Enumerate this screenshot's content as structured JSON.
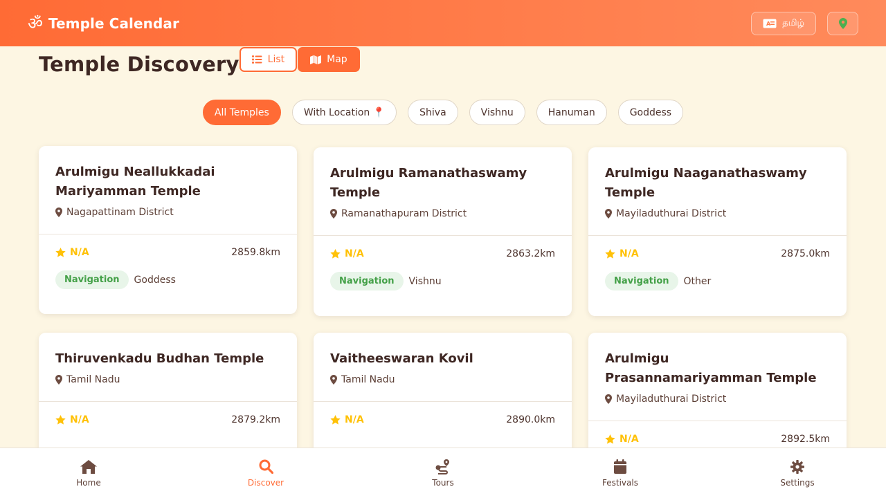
{
  "header": {
    "brand_symbol": "ॐ",
    "title": "Temple Calendar",
    "language_label": "தமிழ்",
    "accent": "#ff6b35"
  },
  "page": {
    "title": "Temple Discovery",
    "view_toggle": {
      "list_label": "List",
      "map_label": "Map",
      "selected": "Map"
    }
  },
  "filters": [
    {
      "label": "All Temples",
      "active": true
    },
    {
      "label": "With Location 📍",
      "active": false
    },
    {
      "label": "Shiva",
      "active": false
    },
    {
      "label": "Vishnu",
      "active": false
    },
    {
      "label": "Hanuman",
      "active": false
    },
    {
      "label": "Goddess",
      "active": false
    }
  ],
  "temples": [
    {
      "name": "Arulmigu Neallukkadai Mariyamman Temple",
      "location": "Nagapattinam District",
      "rating": "N/A",
      "distance": "2859.8km",
      "tag": "Navigation",
      "deity": "Goddess"
    },
    {
      "name": "Arulmigu Ramanathaswamy Temple",
      "location": "Ramanathapuram District",
      "rating": "N/A",
      "distance": "2863.2km",
      "tag": "Navigation",
      "deity": "Vishnu"
    },
    {
      "name": "Arulmigu Naaganathaswamy Temple",
      "location": "Mayiladuthurai District",
      "rating": "N/A",
      "distance": "2875.0km",
      "tag": "Navigation",
      "deity": "Other"
    },
    {
      "name": "Thiruvenkadu Budhan Temple",
      "location": "Tamil Nadu",
      "rating": "N/A",
      "distance": "2879.2km",
      "tag": "",
      "deity": ""
    },
    {
      "name": "Vaitheeswaran Kovil",
      "location": "Tamil Nadu",
      "rating": "N/A",
      "distance": "2890.0km",
      "tag": "",
      "deity": ""
    },
    {
      "name": "Arulmigu Prasannamariyamman Temple",
      "location": "Mayiladuthurai District",
      "rating": "N/A",
      "distance": "2892.5km",
      "tag": "",
      "deity": ""
    }
  ],
  "bottom_nav": [
    {
      "label": "Home",
      "icon": "home-icon",
      "active": false
    },
    {
      "label": "Discover",
      "icon": "search-icon",
      "active": true
    },
    {
      "label": "Tours",
      "icon": "route-icon",
      "active": false
    },
    {
      "label": "Festivals",
      "icon": "calendar-icon",
      "active": false
    },
    {
      "label": "Settings",
      "icon": "gear-icon",
      "active": false
    }
  ]
}
